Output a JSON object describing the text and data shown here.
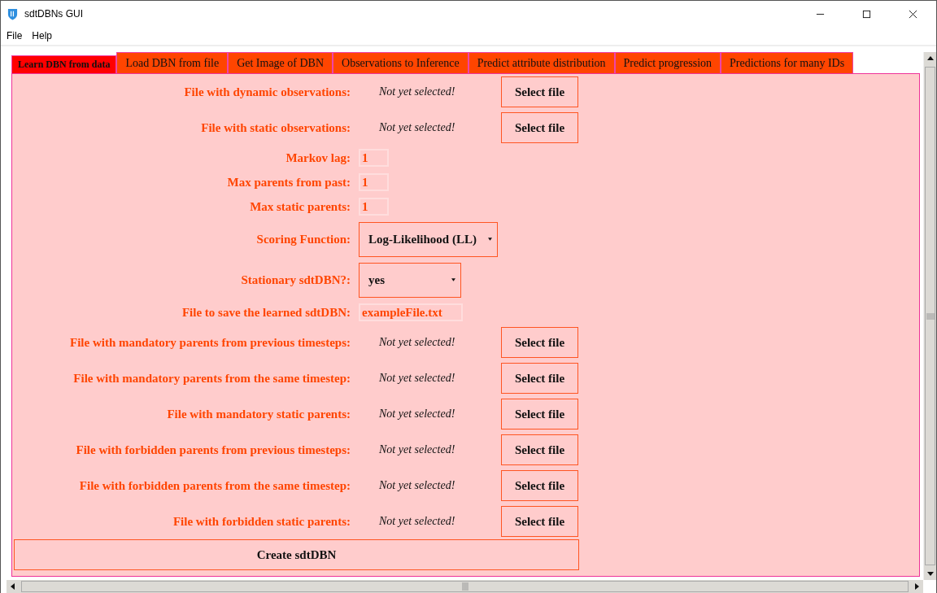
{
  "window": {
    "title": "sdtDBNs GUI"
  },
  "menu": [
    "File",
    "Help"
  ],
  "tabs": [
    {
      "label": "Learn DBN from data",
      "selected": true
    },
    {
      "label": "Load DBN from file",
      "selected": false
    },
    {
      "label": "Get Image of DBN",
      "selected": false
    },
    {
      "label": "Observations to Inference",
      "selected": false
    },
    {
      "label": "Predict attribute distribution",
      "selected": false
    },
    {
      "label": "Predict progression",
      "selected": false
    },
    {
      "label": "Predictions for many IDs",
      "selected": false
    }
  ],
  "form": [
    {
      "kind": "file",
      "label": "File with dynamic observations:",
      "status": "Not yet selected!",
      "button": "Select file"
    },
    {
      "kind": "file",
      "label": "File with static observations:",
      "status": "Not yet selected!",
      "button": "Select file"
    },
    {
      "kind": "entry",
      "label": "Markov lag:",
      "value": "1"
    },
    {
      "kind": "entry",
      "label": "Max parents from past:",
      "value": "1"
    },
    {
      "kind": "entry",
      "label": "Max static parents:",
      "value": "1"
    },
    {
      "kind": "dropdown",
      "label": "Scoring Function:",
      "value": "Log-Likelihood (LL)"
    },
    {
      "kind": "dropdown",
      "label": "Stationary sdtDBN?:",
      "value": "yes"
    },
    {
      "kind": "entry",
      "label": "File to save the learned sdtDBN:",
      "value": "exampleFile.txt"
    },
    {
      "kind": "file",
      "label": "File with mandatory parents from previous timesteps:",
      "status": "Not yet selected!",
      "button": "Select file"
    },
    {
      "kind": "file",
      "label": "File with mandatory parents from the same timestep:",
      "status": "Not yet selected!",
      "button": "Select file"
    },
    {
      "kind": "file",
      "label": "File with mandatory static parents:",
      "status": "Not yet selected!",
      "button": "Select file"
    },
    {
      "kind": "file",
      "label": "File with forbidden parents from previous timesteps:",
      "status": "Not yet selected!",
      "button": "Select file"
    },
    {
      "kind": "file",
      "label": "File with forbidden parents from the same timestep:",
      "status": "Not yet selected!",
      "button": "Select file"
    },
    {
      "kind": "file",
      "label": "File with forbidden static parents:",
      "status": "Not yet selected!",
      "button": "Select file"
    }
  ],
  "create_button": "Create sdtDBN"
}
